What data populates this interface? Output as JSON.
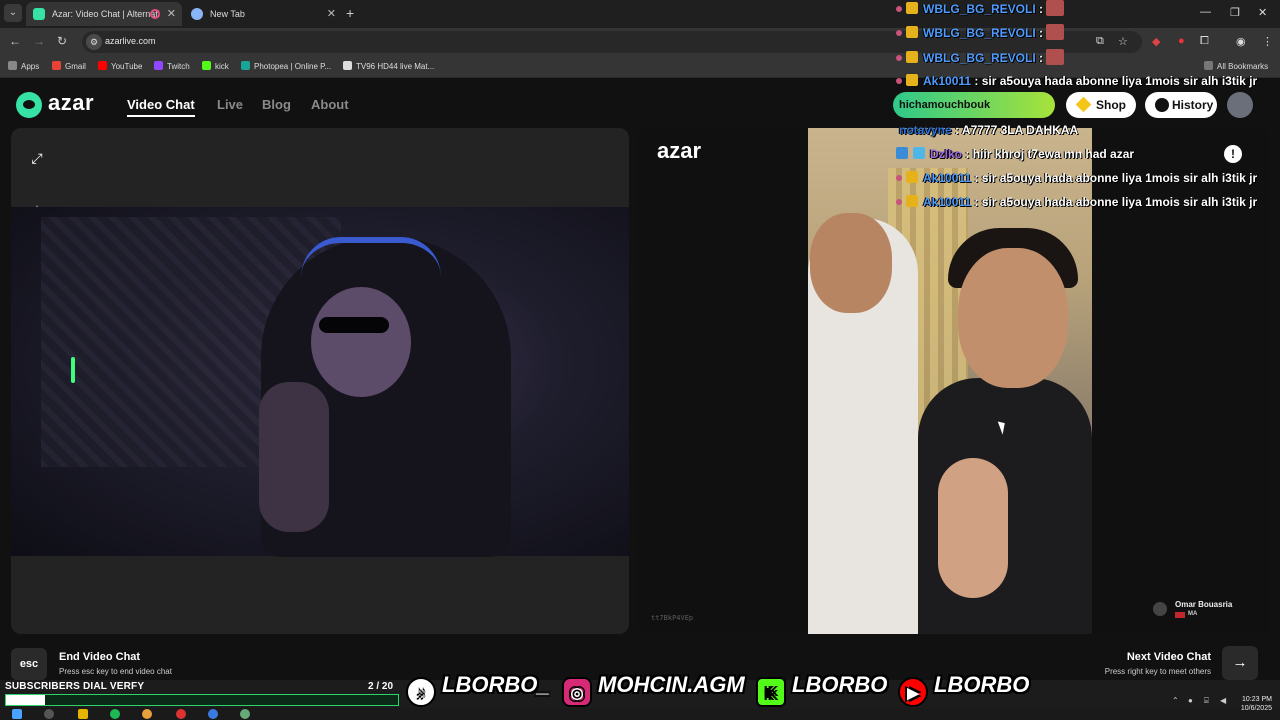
{
  "browser": {
    "tabs": [
      {
        "title": "Azar: Video Chat | Alternati",
        "active": true
      },
      {
        "title": "New Tab",
        "active": false
      }
    ],
    "address": "azarlive.com",
    "bookmarks": [
      "Apps",
      "Gmail",
      "YouTube",
      "Twitch",
      "kick",
      "Photopea | Online P...",
      "TV96 HD44 live Mat..."
    ],
    "all_bookmarks": "All Bookmarks",
    "new_tab_symbol": "+"
  },
  "azar": {
    "logo": "azar",
    "nav": [
      "Video Chat",
      "Live",
      "Blog",
      "About"
    ],
    "user_pill": "hichamouchbouk",
    "shop": "Shop",
    "history": "History",
    "peer_logo": "azar",
    "session_id": "tt7BkP4VEp",
    "peer_name": "Omar Bouasria",
    "peer_country": "MA",
    "report_symbol": "!"
  },
  "controls": {
    "esc_key": "esc",
    "end_title": "End Video Chat",
    "end_sub": "Press esc key to end video chat",
    "next_title": "Next Video Chat",
    "next_sub": "Press right key to meet others",
    "next_arrow": "→"
  },
  "chat": [
    {
      "user": "WBLG_BG_REVOLI",
      "text": ":",
      "color": "#4f9cff",
      "emote": true
    },
    {
      "user": "WBLG_BG_REVOLI",
      "text": ":",
      "color": "#4f9cff",
      "emote": true
    },
    {
      "user": "WBLG_BG_REVOLI",
      "text": ":",
      "color": "#4f9cff",
      "emote": true
    },
    {
      "user": "Ak10011",
      "text": ": sir a5ouya hada abonne liya 1mois sir alh i3tik jr",
      "color": "#4f9cff",
      "emote": false
    },
    {
      "user": "notavyne",
      "text": ": A7777 3LA DAHKAA",
      "color": "#2f74d8",
      "emote": false
    },
    {
      "user": "Dzlko",
      "text": ": hiir khroj t7ewa mn had azar",
      "color": "#9d6be3",
      "emote": false
    },
    {
      "user": "Ak10011",
      "text": ": sir a5ouya hada abonne liya 1mois sir alh i3tik jr",
      "color": "#4f9cff",
      "emote": false
    },
    {
      "user": "Ak10011",
      "text": ": sir a5ouya hada abonne liya 1mois sir alh i3tik jr",
      "color": "#4f9cff",
      "emote": false
    }
  ],
  "overlay": {
    "subs_label": "SUBSCRIBERS DIAL VERFY",
    "subs_count": "2 / 20",
    "subs_progress": 0.1,
    "socials": [
      {
        "icon": "tiktok-icon",
        "handle": "LBORBO_"
      },
      {
        "icon": "instagram-icon",
        "handle": "MOHCIN.AGM"
      },
      {
        "icon": "kick-icon",
        "handle": "LBORBO"
      },
      {
        "icon": "youtube-icon",
        "handle": "LBORBO"
      }
    ]
  },
  "taskbar": {
    "time": "10:23 PM",
    "date": "10/6/2025"
  }
}
